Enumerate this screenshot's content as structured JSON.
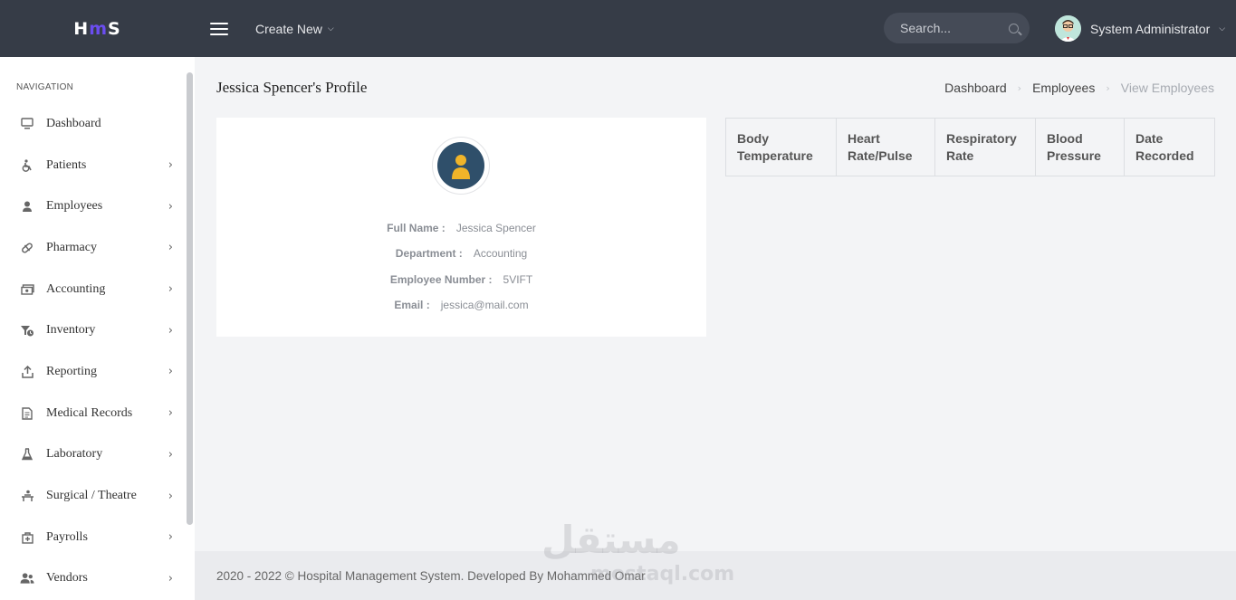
{
  "header": {
    "logo": {
      "part1": "H",
      "part2": "m",
      "part3": "S"
    },
    "create_new_label": "Create New",
    "search_placeholder": "Search...",
    "user_name": "System Administrator"
  },
  "sidebar": {
    "heading": "NAVIGATION",
    "items": [
      {
        "label": "Dashboard",
        "icon": "monitor-icon",
        "has_arrow": false
      },
      {
        "label": "Patients",
        "icon": "wheelchair-icon",
        "has_arrow": true
      },
      {
        "label": "Employees",
        "icon": "user-icon",
        "has_arrow": true
      },
      {
        "label": "Pharmacy",
        "icon": "pill-icon",
        "has_arrow": true
      },
      {
        "label": "Accounting",
        "icon": "money-icon",
        "has_arrow": true
      },
      {
        "label": "Inventory",
        "icon": "inventory-icon",
        "has_arrow": true
      },
      {
        "label": "Reporting",
        "icon": "upload-icon",
        "has_arrow": true
      },
      {
        "label": "Medical Records",
        "icon": "document-icon",
        "has_arrow": true
      },
      {
        "label": "Laboratory",
        "icon": "flask-icon",
        "has_arrow": true
      },
      {
        "label": "Surgical / Theatre",
        "icon": "surgery-icon",
        "has_arrow": true
      },
      {
        "label": "Payrolls",
        "icon": "wallet-icon",
        "has_arrow": true
      },
      {
        "label": "Vendors",
        "icon": "users-icon",
        "has_arrow": true
      }
    ]
  },
  "page": {
    "title": "Jessica Spencer's Profile",
    "breadcrumb": [
      "Dashboard",
      "Employees",
      "View Employees"
    ]
  },
  "profile": {
    "full_name_label": "Full Name :",
    "full_name": "Jessica Spencer",
    "department_label": "Department :",
    "department": "Accounting",
    "employee_number_label": "Employee Number :",
    "employee_number": "5VIFT",
    "email_label": "Email :",
    "email": "jessica@mail.com"
  },
  "vitals_table": {
    "columns": [
      [
        "Body",
        "Temperature"
      ],
      [
        "Heart",
        "Rate/Pulse"
      ],
      [
        "Respiratory",
        "Rate"
      ],
      [
        "Blood",
        "Pressure"
      ],
      [
        "Date",
        "Recorded"
      ]
    ]
  },
  "footer": {
    "text": "2020 - 2022 © Hospital Management System. Developed By Mohammed Omar"
  },
  "watermark": {
    "arabic": "مستقل",
    "latin": "mostaql.com"
  },
  "colors": {
    "topbar": "#363c47",
    "accent": "#6b4df0",
    "avatar_bg": "#2f4f6a",
    "avatar_fg": "#f0b429"
  }
}
